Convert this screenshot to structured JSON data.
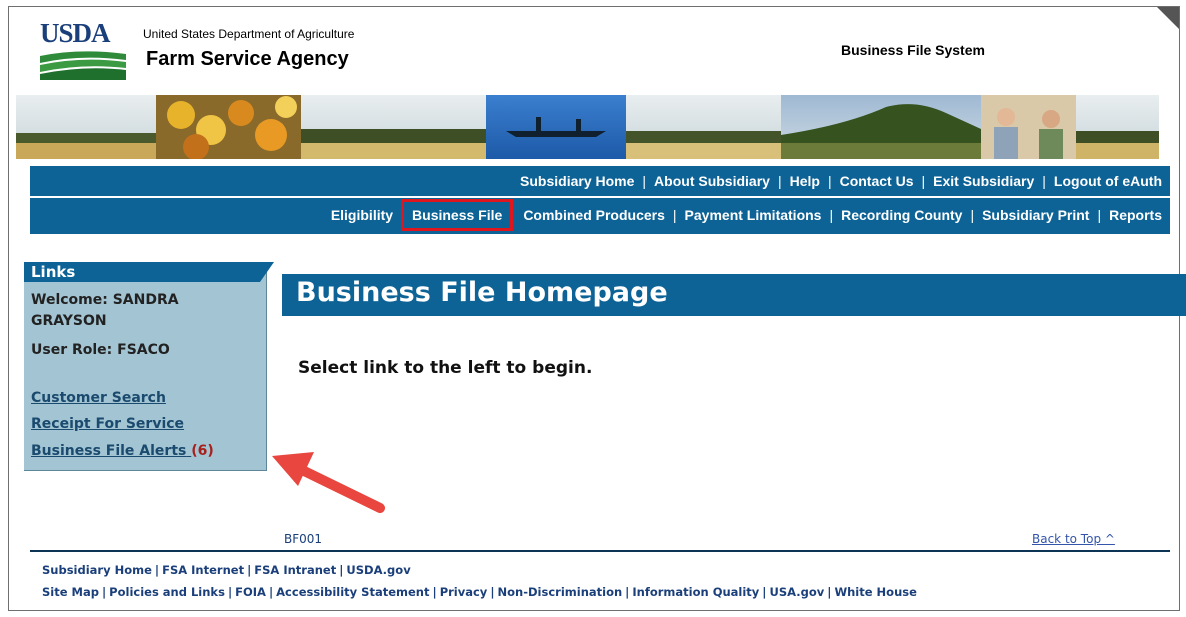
{
  "header": {
    "logo_text": "USDA",
    "department": "United States Department of Agriculture",
    "agency": "Farm Service Agency",
    "system": "Business File System"
  },
  "top_nav": [
    "Subsidiary Home",
    "About Subsidiary",
    "Help",
    "Contact Us",
    "Exit Subsidiary",
    "Logout of eAuth"
  ],
  "main_nav": {
    "eligibility": "Eligibility",
    "business_file": "Business File",
    "others": [
      "Combined Producers",
      "Payment Limitations",
      "Recording County",
      "Subsidiary Print",
      "Reports"
    ]
  },
  "links_panel": {
    "title": "Links",
    "welcome": "Welcome: SANDRA GRAYSON",
    "user_role": "User Role: FSACO",
    "customer_search": "Customer Search",
    "receipt_for_service": "Receipt For Service",
    "alerts_label": "Business File Alerts",
    "alerts_count": "(6)"
  },
  "main": {
    "title": "Business File Homepage",
    "instruction": "Select link to the left to begin."
  },
  "page_id": "BF001",
  "back_to_top": "Back to Top ^",
  "footer_row1": [
    "Subsidiary Home",
    "FSA Internet",
    "FSA Intranet",
    "USDA.gov"
  ],
  "footer_row2": [
    "Site Map",
    "Policies and Links",
    "FOIA",
    "Accessibility Statement",
    "Privacy",
    "Non-Discrimination",
    "Information Quality",
    "USA.gov",
    "White House"
  ],
  "colors": {
    "nav_blue": "#0d6396",
    "panel_blue": "#a3c4d3",
    "highlight_red": "#e0161e",
    "alert_red": "#a7201c"
  }
}
